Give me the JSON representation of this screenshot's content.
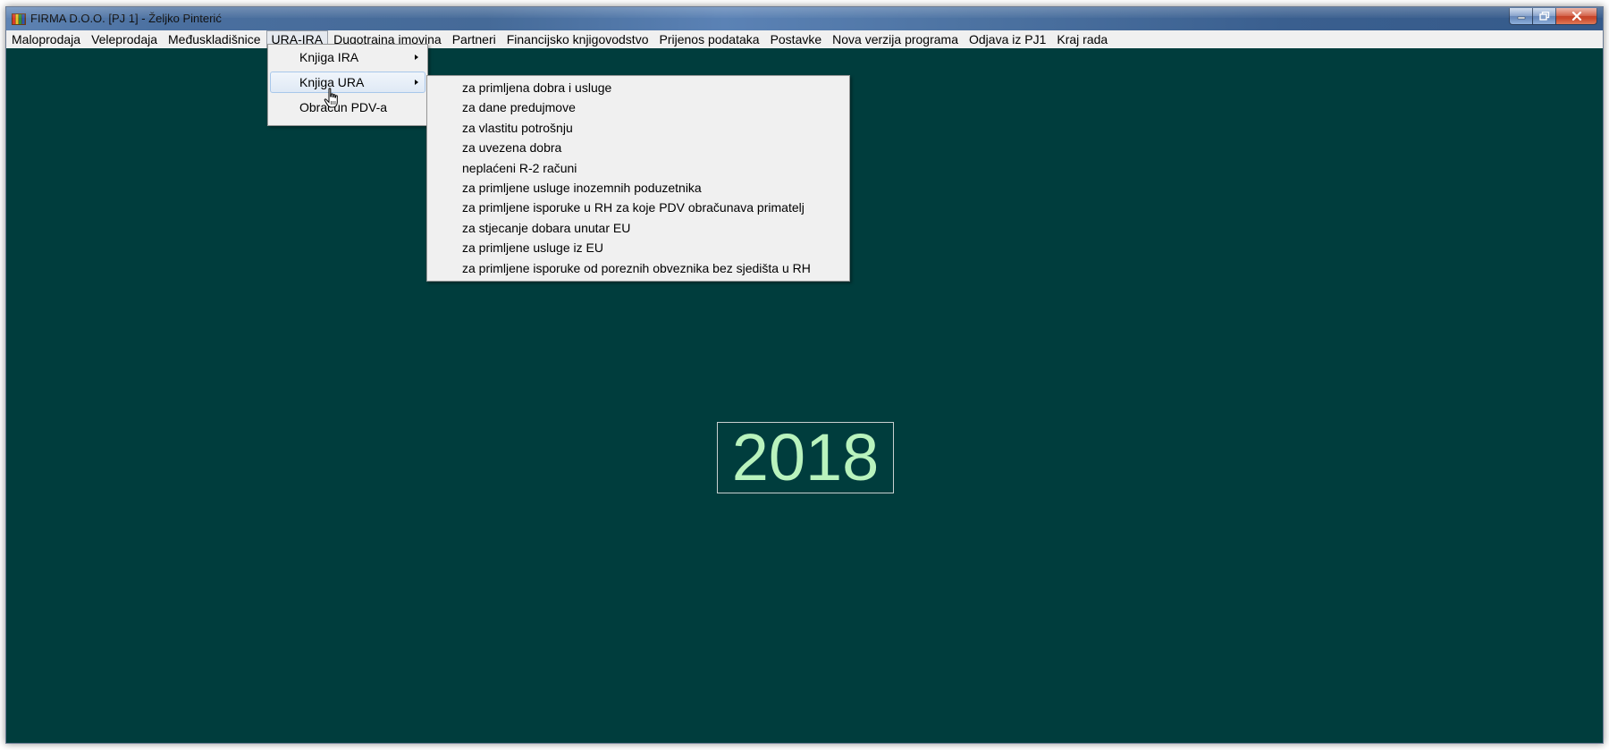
{
  "window": {
    "title": "FIRMA D.O.O. [PJ 1] - Željko Pinterić"
  },
  "window_controls": {
    "minimize_icon": "minimize-icon",
    "maximize_icon": "maximize-icon",
    "close_icon": "close-icon"
  },
  "menubar": {
    "items": [
      {
        "label": "Maloprodaja"
      },
      {
        "label": "Veleprodaja"
      },
      {
        "label": "Međuskladišnice"
      },
      {
        "label": "URA-IRA"
      },
      {
        "label": "Dugotrajna imovina"
      },
      {
        "label": "Partneri"
      },
      {
        "label": "Financijsko knjigovodstvo"
      },
      {
        "label": "Prijenos podataka"
      },
      {
        "label": "Postavke"
      },
      {
        "label": "Nova verzija programa"
      },
      {
        "label": "Odjava iz PJ1"
      },
      {
        "label": "Kraj rada"
      }
    ],
    "open_item": "URA-IRA"
  },
  "ura_ira_menu": {
    "items": [
      {
        "label": "Knjiga IRA",
        "has_submenu": true
      },
      {
        "label": "Knjiga URA",
        "has_submenu": true
      },
      {
        "label": "Obračun PDV-a",
        "has_submenu": false
      }
    ],
    "highlighted": "Knjiga URA"
  },
  "knjiga_ura_menu": {
    "items": [
      {
        "label": "za primljena dobra i usluge"
      },
      {
        "label": "za dane predujmove"
      },
      {
        "label": "za vlastitu potrošnju"
      },
      {
        "label": "za uvezena dobra"
      },
      {
        "label": "neplaćeni R-2 računi"
      },
      {
        "label": "za primljene usluge inozemnih poduzetnika"
      },
      {
        "label": "za primljene isporuke u RH za koje PDV obračunava primatelj"
      },
      {
        "label": "za stjecanje dobara unutar EU"
      },
      {
        "label": "za primljene usluge iz EU"
      },
      {
        "label": "za primljene isporuke od poreznih obveznika bez sjedišta u RH"
      }
    ]
  },
  "main": {
    "year": "2018"
  },
  "colors": {
    "client_background": "#003d3d",
    "year_text": "#b9f3bd"
  }
}
